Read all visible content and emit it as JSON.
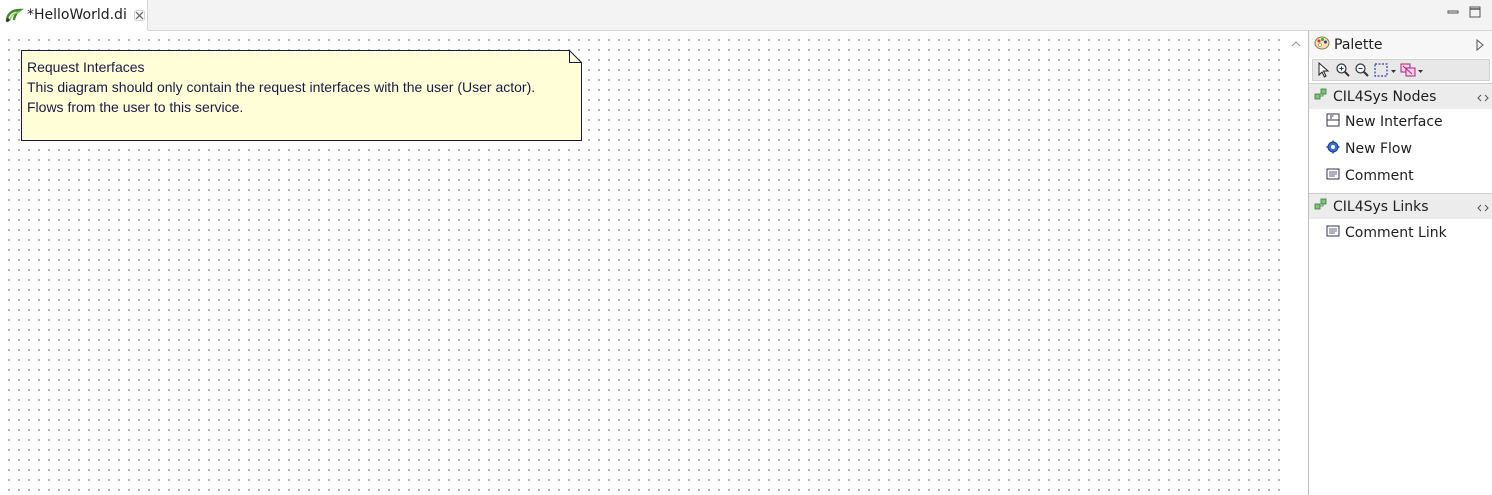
{
  "editor": {
    "tab_title": "*HelloWorld.di",
    "tab_icon": "papyrus-diagram-icon",
    "close_icon": "close-icon"
  },
  "window_controls": {
    "minimize_icon": "minimize-icon",
    "maximize_icon": "maximize-icon"
  },
  "note": {
    "title": "Request Interfaces",
    "line1": "This diagram should only contain the request interfaces with the user (User actor).",
    "line2": "Flows from the user to this service.",
    "fill_color": "#fffed7",
    "border_color": "#1a1a4a"
  },
  "palette": {
    "title": "Palette",
    "toolbar_icons": [
      "select-icon",
      "zoom-in-icon",
      "zoom-out-icon",
      "marquee-icon",
      "note-attachment-icon"
    ],
    "drawers": [
      {
        "title": "CIL4Sys Nodes",
        "entries": [
          {
            "label": "New Interface",
            "icon": "interface-icon"
          },
          {
            "label": "New Flow",
            "icon": "flow-icon"
          },
          {
            "label": "Comment",
            "icon": "comment-icon"
          }
        ]
      },
      {
        "title": "CIL4Sys Links",
        "entries": [
          {
            "label": "Comment Link",
            "icon": "comment-link-icon"
          }
        ]
      }
    ]
  }
}
